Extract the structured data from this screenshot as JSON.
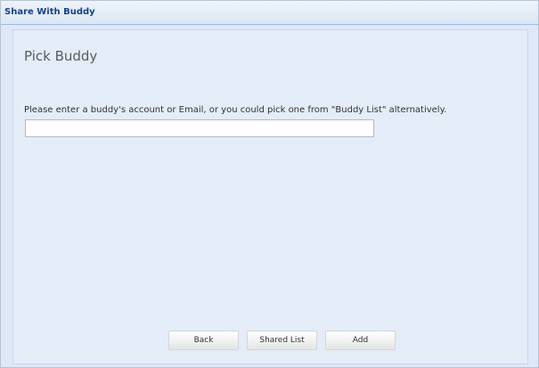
{
  "dialog": {
    "title": "Share With Buddy",
    "heading": "Pick Buddy",
    "prompt": "Please enter a buddy's account or Email, or you could pick one from \"Buddy List\" alternatively.",
    "buddy_input": {
      "value": "",
      "placeholder": ""
    },
    "buttons": {
      "back": "Back",
      "shared_list": "Shared List",
      "add": "Add"
    }
  },
  "colors": {
    "title_text": "#15428b",
    "panel_background": "#dfe8f6",
    "border": "#99bbe8"
  }
}
